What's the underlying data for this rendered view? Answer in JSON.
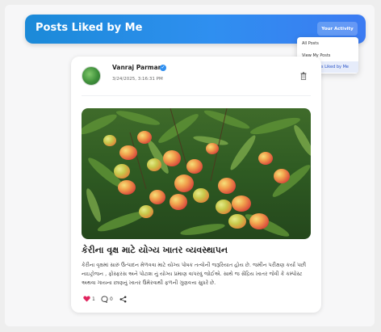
{
  "header": {
    "title": "Posts Liked by Me",
    "activity_button": "Your Activity"
  },
  "dropdown": {
    "items": [
      {
        "label": "All Posts"
      },
      {
        "label": "View My Posts"
      },
      {
        "label": "View Posts Liked by Me"
      }
    ]
  },
  "post": {
    "author": "Vanraj Parmar",
    "timestamp": "3/24/2025, 3:16:31 PM",
    "title": "કેરીના વૃક્ષ માટે યોગ્ય ખાતર વ્યવસ્થાપન",
    "body": "કેરીના વૃક્ષમાં સારું ઉત્પાદન મેળવવા માટે યોગ્ય પોષક તત્વોની જરૂરિયાત હોય છે. જમીન પરીક્ષણ કર્યા પછી નાઇટ્રોજન , ફોસ્ફરસ અને પોટાશ નું યોગ્ય પ્રમાણ વાપરવું જોઈએ. સાથે જ સેંદ્રિય ખાતર જેવી કે કમ્પોસ્ટ અથવા ગાયના છાણનું ખાતર ઉમેરવાથી ફળની ગુણવત્તા સુધરે છે.",
    "likes": "1",
    "comments": "0"
  },
  "colors": {
    "header_gradient_start": "#1b8ad8",
    "header_gradient_end": "#3c7bf2",
    "like_color": "#e0245e",
    "active_menu_bg": "#e6ecfa"
  },
  "icons": [
    "verified-icon",
    "trash-icon",
    "heart-icon",
    "comment-icon",
    "share-icon"
  ]
}
